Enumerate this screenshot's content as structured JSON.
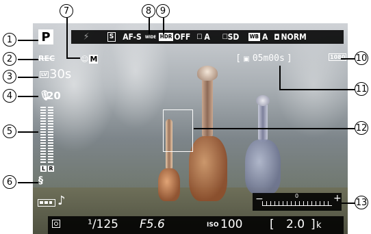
{
  "callouts": [
    "1",
    "2",
    "3",
    "4",
    "5",
    "6",
    "7",
    "8",
    "9",
    "10",
    "11",
    "12",
    "13"
  ],
  "screen": {
    "mode": "P",
    "shutter_time": "30s",
    "mic_level": "20",
    "lr_labels": [
      "L",
      "R"
    ],
    "top_bar": {
      "picture_control_box": "S",
      "af_mode": "AF-S",
      "area_mode": "WIDE",
      "hdr": "OFF",
      "adl": "A",
      "picture_control": "SD",
      "wb": "WB",
      "wb_value": "A",
      "quality": "NORM"
    },
    "af_area_mode": "M",
    "remaining_time": "05m00s",
    "movie_size": "1080",
    "movie_rate": "30",
    "exposure_minus": "−",
    "exposure_zero": "0",
    "exposure_plus": "+",
    "bottom_bar": {
      "shutter_speed": "¹/125",
      "aperture": "F5.6",
      "iso_label": "ISO",
      "iso_value": "100",
      "shots_remaining": "2.0",
      "shots_unit": "k"
    }
  }
}
